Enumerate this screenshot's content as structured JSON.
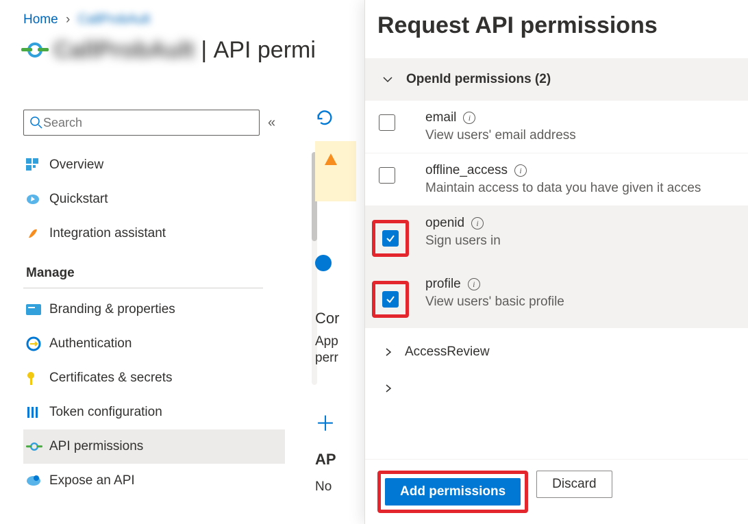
{
  "breadcrumb": {
    "home": "Home",
    "app": "CallProbAult"
  },
  "title": {
    "app": "CallProbAult",
    "page": "API permi"
  },
  "search": {
    "placeholder": "Search"
  },
  "nav": {
    "top": [
      {
        "label": "Overview"
      },
      {
        "label": "Quickstart"
      },
      {
        "label": "Integration assistant"
      }
    ],
    "group": "Manage",
    "manage": [
      {
        "label": "Branding & properties"
      },
      {
        "label": "Authentication"
      },
      {
        "label": "Certificates & secrets"
      },
      {
        "label": "Token configuration"
      },
      {
        "label": "API permissions"
      },
      {
        "label": "Expose an API"
      }
    ]
  },
  "mainpeek": {
    "hdr1": "Cor",
    "p1": "App",
    "p2": "perr",
    "hdr2": "AP",
    "p3": "No"
  },
  "panel": {
    "title": "Request API permissions",
    "group": "OpenId permissions (2)",
    "perms": [
      {
        "name": "email",
        "desc": "View users' email address",
        "checked": false
      },
      {
        "name": "offline_access",
        "desc": "Maintain access to data you have given it acces",
        "checked": false
      },
      {
        "name": "openid",
        "desc": "Sign users in",
        "checked": true
      },
      {
        "name": "profile",
        "desc": "View users' basic profile",
        "checked": true
      }
    ],
    "subgroup": "AccessReview",
    "add": "Add permissions",
    "discard": "Discard"
  }
}
